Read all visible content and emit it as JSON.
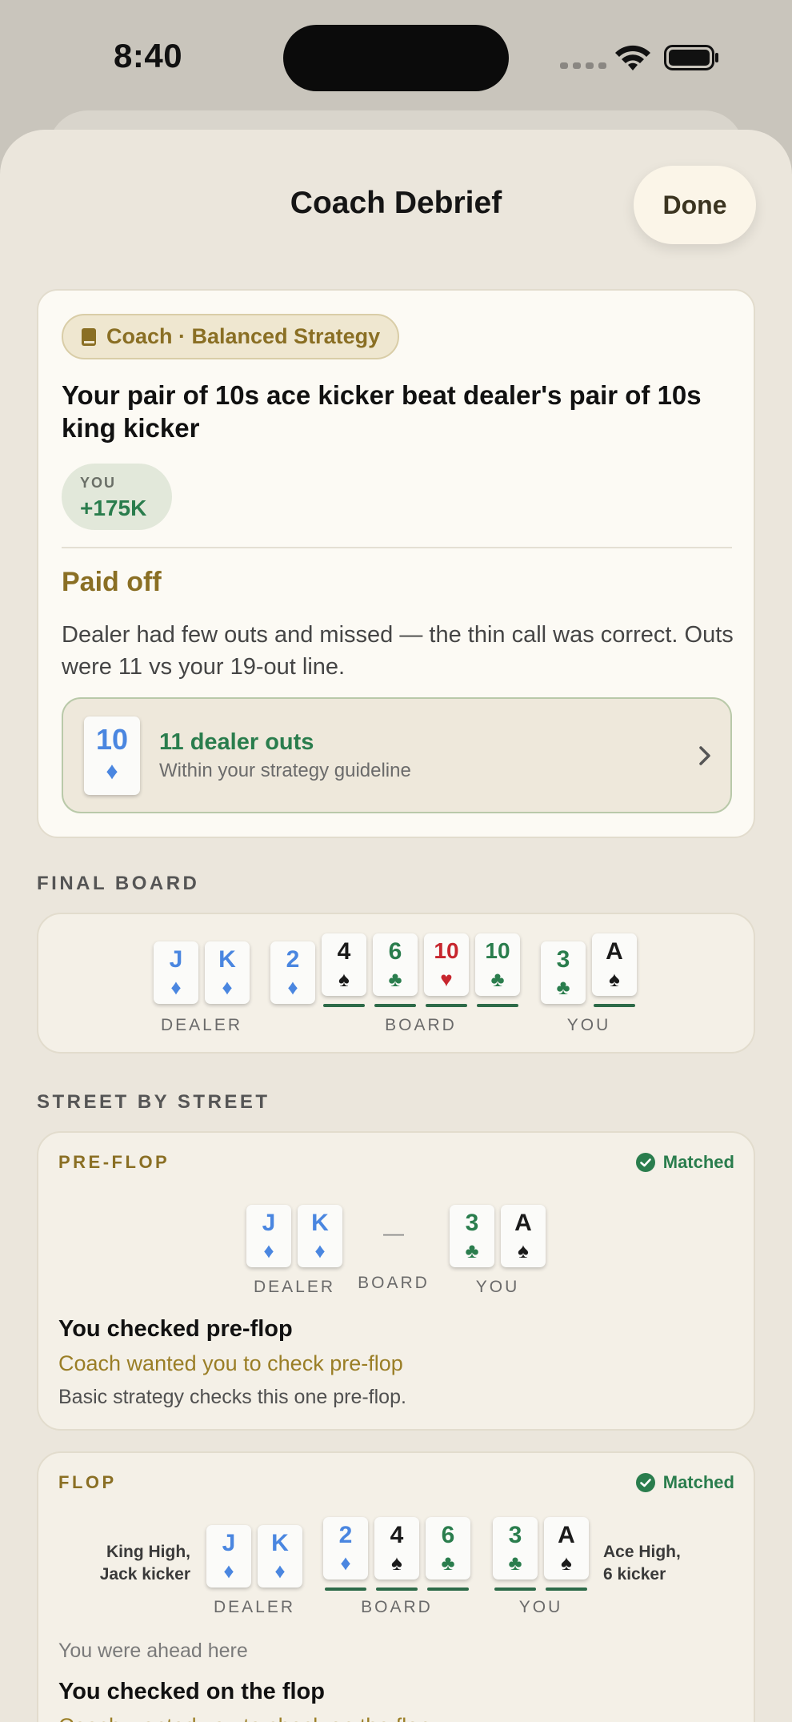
{
  "status_bar": {
    "time": "8:40"
  },
  "header": {
    "title": "Coach Debrief",
    "done_label": "Done"
  },
  "coach": {
    "badge": "Coach · Balanced Strategy",
    "headline": "Your pair of 10s ace kicker beat dealer's pair of 10s king kicker",
    "you_label": "YOU",
    "you_amount": "+175K",
    "verdict": "Paid off",
    "explanation": "Dealer had few outs and missed — the thin call was correct. Outs were 11 vs your 19-out line.",
    "outs_card": {
      "rank": "10",
      "suit": "♦"
    },
    "outs_title": "11 dealer outs",
    "outs_subtitle": "Within your strategy guideline"
  },
  "final_board": {
    "label": "FINAL BOARD",
    "dealer_label": "DEALER",
    "board_label": "BOARD",
    "you_label": "YOU",
    "dealer": [
      {
        "rank": "J",
        "suit": "♦"
      },
      {
        "rank": "K",
        "suit": "♦"
      }
    ],
    "board": [
      {
        "rank": "2",
        "suit": "♦"
      },
      {
        "rank": "4",
        "suit": "♠"
      },
      {
        "rank": "6",
        "suit": "♣"
      },
      {
        "rank": "10",
        "suit": "♥"
      },
      {
        "rank": "10",
        "suit": "♣"
      }
    ],
    "you": [
      {
        "rank": "3",
        "suit": "♣"
      },
      {
        "rank": "A",
        "suit": "♠"
      }
    ]
  },
  "street_by_street": {
    "label": "STREET BY STREET",
    "preflop": {
      "name": "PRE-FLOP",
      "status": "Matched",
      "dealer_label": "DEALER",
      "board_label": "BOARD",
      "board_placeholder": "—",
      "you_label": "YOU",
      "dealer": [
        {
          "rank": "J",
          "suit": "♦"
        },
        {
          "rank": "K",
          "suit": "♦"
        }
      ],
      "you": [
        {
          "rank": "3",
          "suit": "♣"
        },
        {
          "rank": "A",
          "suit": "♠"
        }
      ],
      "action": "You checked pre-flop",
      "coach_line": "Coach wanted you to check pre-flop",
      "note": "Basic strategy checks this one pre-flop."
    },
    "flop": {
      "name": "FLOP",
      "status": "Matched",
      "dealer_hand_line1": "King High,",
      "dealer_hand_line2": "Jack kicker",
      "you_hand_line1": "Ace High,",
      "you_hand_line2": "6 kicker",
      "dealer_label": "DEALER",
      "board_label": "BOARD",
      "you_label": "YOU",
      "dealer": [
        {
          "rank": "J",
          "suit": "♦"
        },
        {
          "rank": "K",
          "suit": "♦"
        }
      ],
      "board": [
        {
          "rank": "2",
          "suit": "♦"
        },
        {
          "rank": "4",
          "suit": "♠"
        },
        {
          "rank": "6",
          "suit": "♣"
        }
      ],
      "you": [
        {
          "rank": "3",
          "suit": "♣"
        },
        {
          "rank": "A",
          "suit": "♠"
        }
      ],
      "ahead_note": "You were ahead here",
      "action": "You checked on the flop",
      "coach_line": "Coach wanted you to check on the flop"
    }
  },
  "colors": {
    "diamond": "#4a86e0",
    "spade": "#1a1a1a",
    "club": "#2a7d4d",
    "heart": "#c7262e",
    "accent_gold": "#8a6f24"
  }
}
